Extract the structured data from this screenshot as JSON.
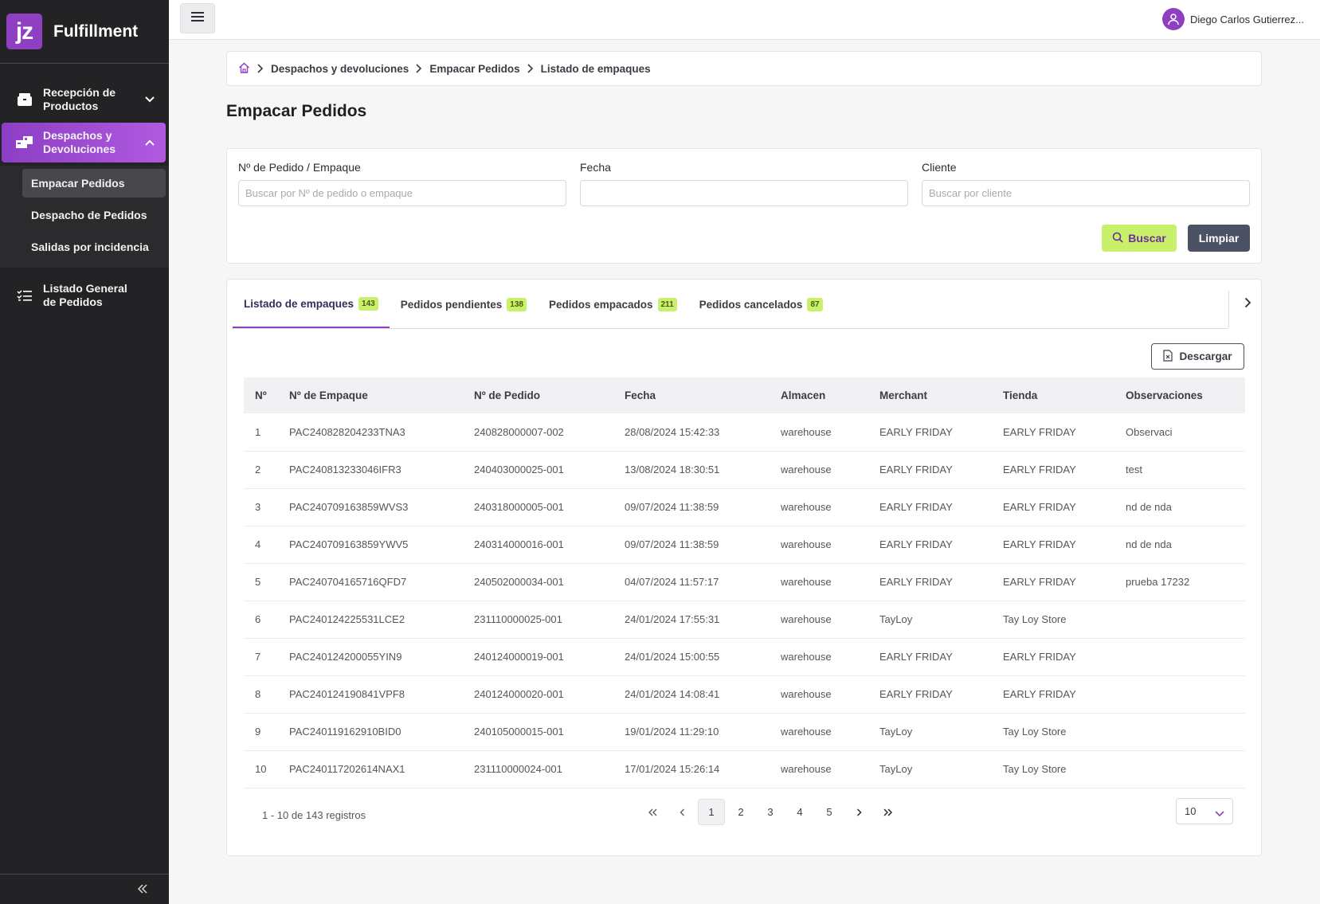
{
  "brand": {
    "logo": "jz",
    "name": "Fulfillment"
  },
  "sidebar": {
    "items": [
      {
        "label": "Recepción de Productos",
        "icon": "box-icon"
      },
      {
        "label": "Despachos y Devoluciones",
        "icon": "truck-icon"
      },
      {
        "label": "Listado General de Pedidos",
        "icon": "list-icon"
      }
    ],
    "subitems": [
      "Empacar Pedidos",
      "Despacho de Pedidos",
      "Salidas por incidencia"
    ]
  },
  "topbar": {
    "user_name": "Diego Carlos Gutierrez..."
  },
  "breadcrumb": [
    "Despachos y devoluciones",
    "Empacar Pedidos",
    "Listado de empaques"
  ],
  "page_title": "Empacar Pedidos",
  "filters": {
    "order_label": "Nº de Pedido / Empaque",
    "order_placeholder": "Buscar por Nº de pedido o empaque",
    "date_label": "Fecha",
    "client_label": "Cliente",
    "client_placeholder": "Buscar por cliente",
    "search_label": "Buscar",
    "clear_label": "Limpiar"
  },
  "tabs": [
    {
      "label": "Listado de empaques",
      "count": "143"
    },
    {
      "label": "Pedidos pendientes",
      "count": "138"
    },
    {
      "label": "Pedidos empacados",
      "count": "211"
    },
    {
      "label": "Pedidos cancelados",
      "count": "87"
    }
  ],
  "download_label": "Descargar",
  "table": {
    "headers": [
      "Nº",
      "Nº de Empaque",
      "Nº de Pedido",
      "Fecha",
      "Almacen",
      "Merchant",
      "Tienda",
      "Observaciones"
    ],
    "rows": [
      [
        "1",
        "PAC240828204233TNA3",
        "240828000007-002",
        "28/08/2024 15:42:33",
        "warehouse",
        "EARLY FRIDAY",
        "EARLY FRIDAY",
        "Observaci"
      ],
      [
        "2",
        "PAC240813233046IFR3",
        "240403000025-001",
        "13/08/2024 18:30:51",
        "warehouse",
        "EARLY FRIDAY",
        "EARLY FRIDAY",
        "test"
      ],
      [
        "3",
        "PAC240709163859WVS3",
        "240318000005-001",
        "09/07/2024 11:38:59",
        "warehouse",
        "EARLY FRIDAY",
        "EARLY FRIDAY",
        "nd de nda"
      ],
      [
        "4",
        "PAC240709163859YWV5",
        "240314000016-001",
        "09/07/2024 11:38:59",
        "warehouse",
        "EARLY FRIDAY",
        "EARLY FRIDAY",
        "nd de nda"
      ],
      [
        "5",
        "PAC240704165716QFD7",
        "240502000034-001",
        "04/07/2024 11:57:17",
        "warehouse",
        "EARLY FRIDAY",
        "EARLY FRIDAY",
        "prueba 17232"
      ],
      [
        "6",
        "PAC240124225531LCE2",
        "231110000025-001",
        "24/01/2024 17:55:31",
        "warehouse",
        "TayLoy",
        "Tay Loy Store",
        ""
      ],
      [
        "7",
        "PAC240124200055YIN9",
        "240124000019-001",
        "24/01/2024 15:00:55",
        "warehouse",
        "EARLY FRIDAY",
        "EARLY FRIDAY",
        ""
      ],
      [
        "8",
        "PAC240124190841VPF8",
        "240124000020-001",
        "24/01/2024 14:08:41",
        "warehouse",
        "EARLY FRIDAY",
        "EARLY FRIDAY",
        ""
      ],
      [
        "9",
        "PAC240119162910BID0",
        "240105000015-001",
        "19/01/2024 11:29:10",
        "warehouse",
        "TayLoy",
        "Tay Loy Store",
        ""
      ],
      [
        "10",
        "PAC240117202614NAX1",
        "231110000024-001",
        "17/01/2024 15:26:14",
        "warehouse",
        "TayLoy",
        "Tay Loy Store",
        ""
      ]
    ]
  },
  "pagination": {
    "info": "1 - 10 de 143 registros",
    "pages": [
      "1",
      "2",
      "3",
      "4",
      "5"
    ],
    "current": "1",
    "page_size": "10"
  },
  "colors": {
    "accent": "#8e3fc2",
    "lime": "#c9f06a",
    "sidebar": "#232325",
    "slate": "#4b5263"
  }
}
